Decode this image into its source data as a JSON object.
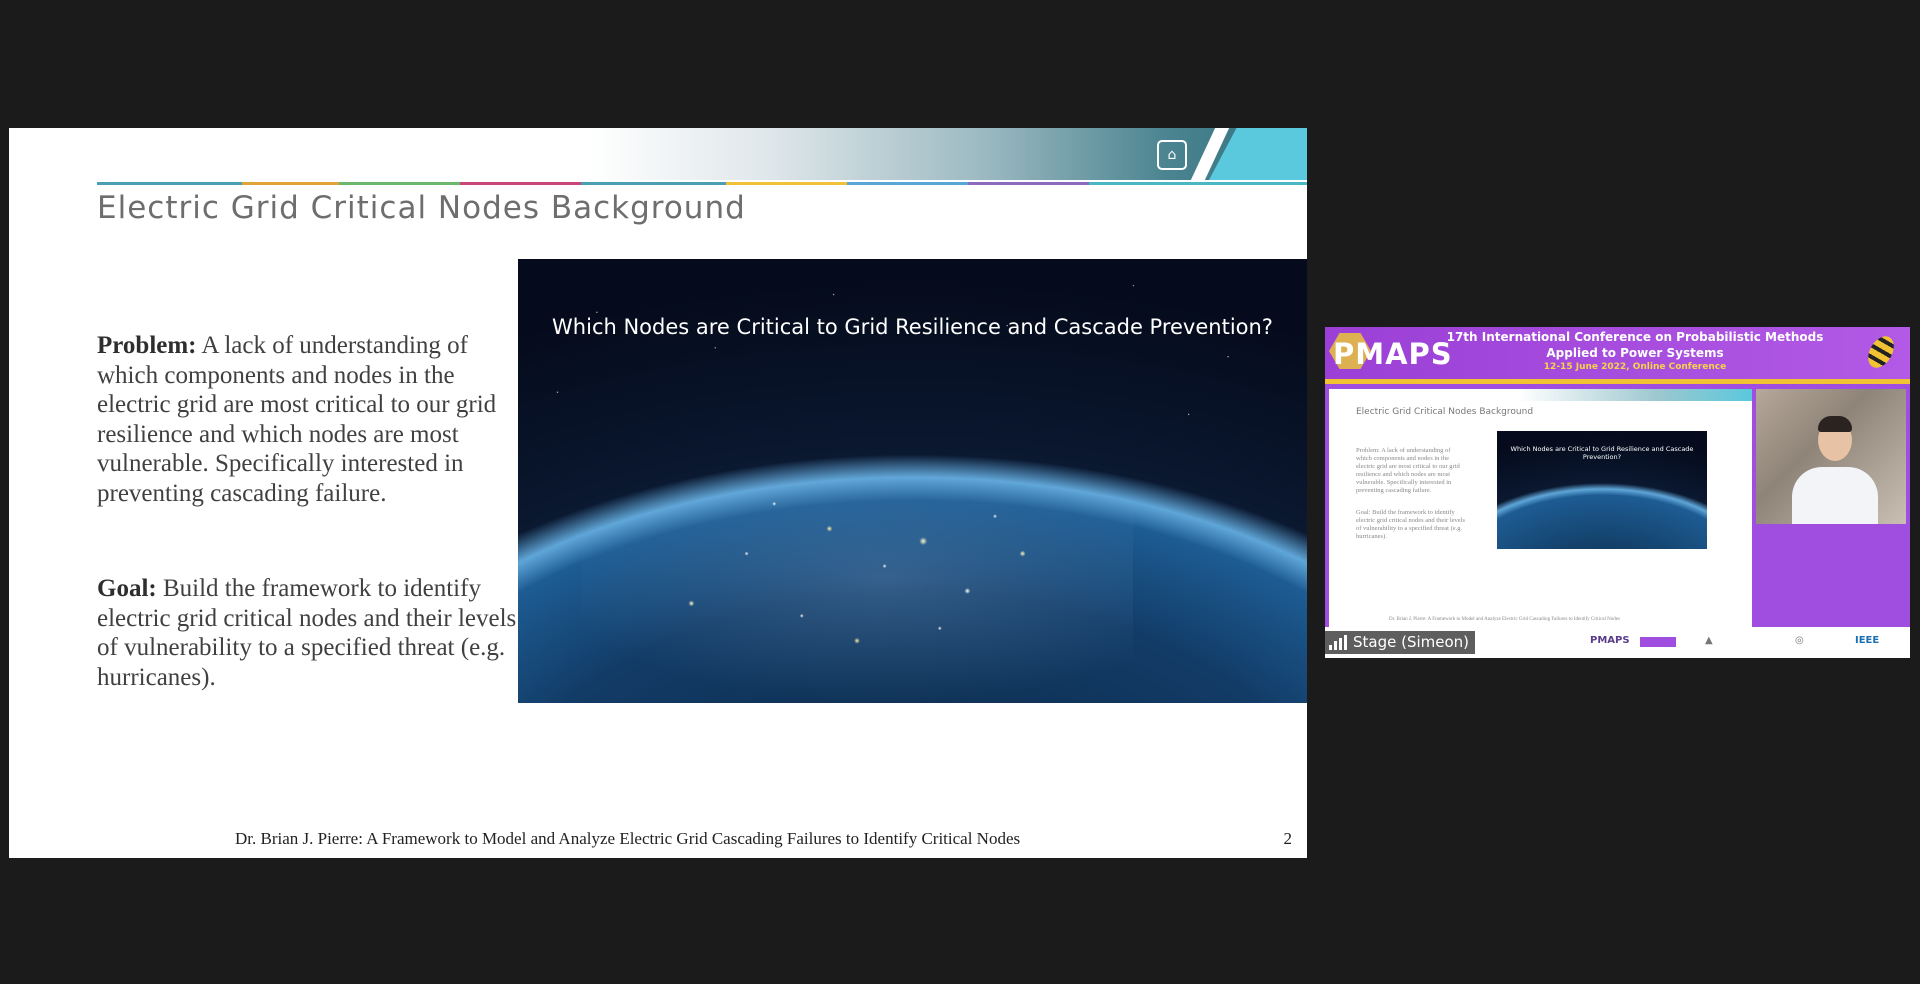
{
  "slide": {
    "title": "Electric Grid Critical Nodes Background",
    "problem_label": "Problem:",
    "problem_text": "A lack of understanding of which components and nodes in the electric grid are most critical to our grid resilience and which nodes are most vulnerable. Specifically interested in preventing cascading failure.",
    "goal_label": "Goal:",
    "goal_text": "Build the framework to identify electric grid critical nodes and their levels of vulnerability to a specified threat (e.g. hurricanes).",
    "image_caption": "Which Nodes are Critical to Grid Resilience and Cascade Prevention?",
    "footer": "Dr. Brian J. Pierre: A Framework to Model and Analyze Electric Grid Cascading Failures to Identify Critical Nodes",
    "page_number": "2",
    "logo_icon": "sandia-logo-icon"
  },
  "thumbnail": {
    "brand": "PMAPS",
    "conference_line1": "17th International Conference on Probabilistic Methods",
    "conference_line2": "Applied to Power Systems",
    "conference_dates": "12-15 June 2022, Online Conference",
    "mini_title": "Electric Grid Critical Nodes Background",
    "mini_problem": "Problem: A lack of understanding of which components and nodes in the electric grid are most critical to our grid resilience and which nodes are most vulnerable. Specifically interested in preventing cascading failure.",
    "mini_goal": "Goal: Build the framework to identify electric grid critical nodes and their levels of vulnerability to a specified threat (e.g. hurricanes).",
    "mini_caption": "Which Nodes are Critical to Grid Resilience and Cascade Prevention?",
    "mini_footer": "Dr. Brian J. Pierre: A Framework to Model and Analyze Electric Grid Cascading Failures to Identify Critical Nodes",
    "stage_label": "Stage (Simeon)",
    "sponsor_logos": [
      "PMAPS",
      "IEEE"
    ]
  },
  "colors": {
    "background": "#1b1b1b",
    "thumbnail_purple": "#a04ee0",
    "accent_cyan": "#5ac8dd"
  }
}
